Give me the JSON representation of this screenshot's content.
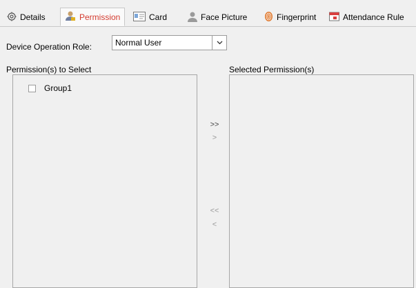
{
  "tabs": [
    {
      "label": "Details",
      "icon": "gear-icon",
      "active": false
    },
    {
      "label": "Permission",
      "icon": "user-permission-icon",
      "active": true
    },
    {
      "label": "Card",
      "icon": "card-icon",
      "active": false
    },
    {
      "label": "Face Picture",
      "icon": "face-icon",
      "active": false
    },
    {
      "label": "Fingerprint",
      "icon": "fingerprint-icon",
      "active": false
    },
    {
      "label": "Attendance Rule",
      "icon": "calendar-icon",
      "active": false
    }
  ],
  "role": {
    "label": "Device Operation Role:",
    "value": "Normal User"
  },
  "left_panel": {
    "header": "Permission(s) to Select",
    "items": [
      {
        "label": "Group1",
        "checked": false
      }
    ]
  },
  "right_panel": {
    "header": "Selected Permission(s)"
  },
  "move_buttons": {
    "add_all": ">>",
    "add": ">",
    "remove_all": "<<",
    "remove": "<"
  },
  "colors": {
    "active_tab_text": "#d33a2e",
    "background": "#f0f0f0"
  }
}
